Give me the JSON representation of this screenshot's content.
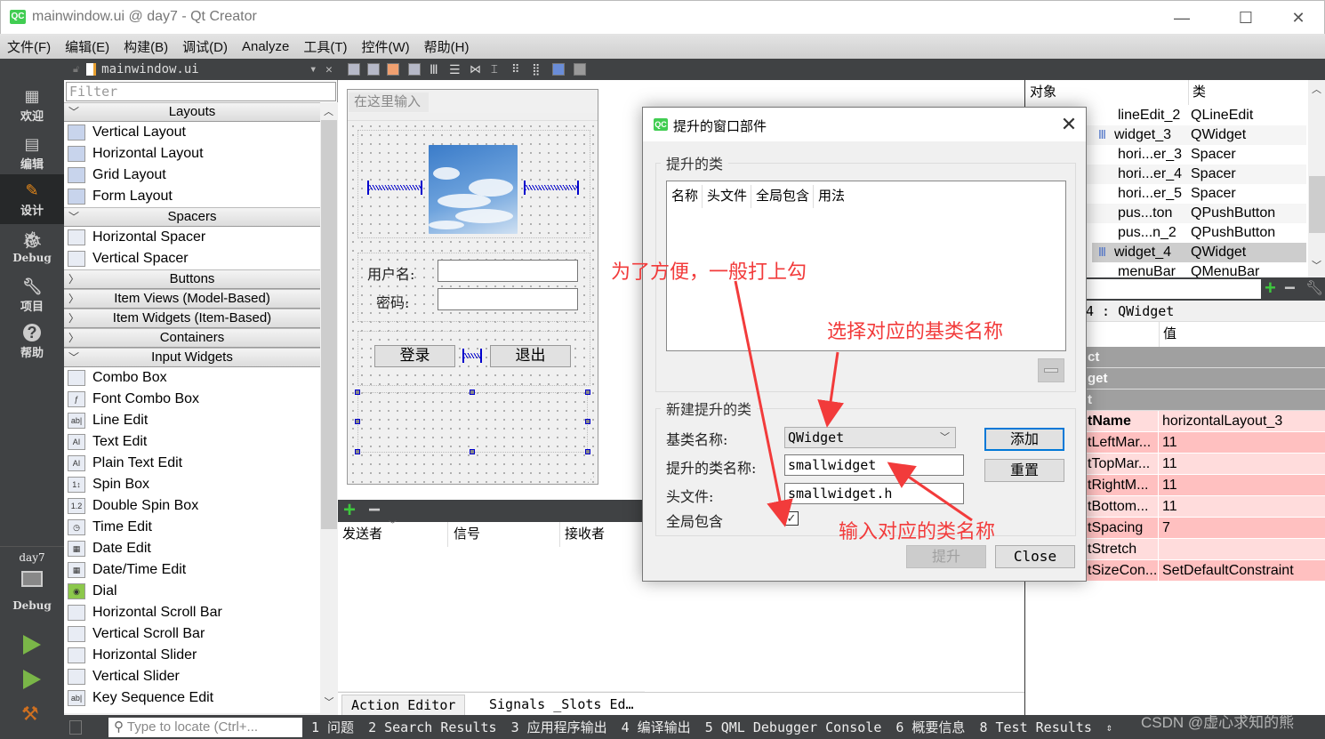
{
  "window": {
    "title": "mainwindow.ui @ day7 - Qt Creator",
    "app_icon": "QC",
    "controls": {
      "minimize": "—",
      "maximize": "☐",
      "close": "✕"
    }
  },
  "menu": [
    "文件(F)",
    "编辑(E)",
    "构建(B)",
    "调试(D)",
    "Analyze",
    "工具(T)",
    "控件(W)",
    "帮助(H)"
  ],
  "editor_tab": {
    "file": "mainwindow.ui",
    "dropdown": "▾",
    "close": "✕"
  },
  "modes": [
    {
      "label": "欢迎",
      "icon": "grid-icon"
    },
    {
      "label": "编辑",
      "icon": "document-icon"
    },
    {
      "label": "设计",
      "icon": "pencil-icon",
      "active": true
    },
    {
      "label": "Debug",
      "icon": "bug-icon"
    },
    {
      "label": "项目",
      "icon": "wrench-icon"
    },
    {
      "label": "帮助",
      "icon": "help-icon"
    }
  ],
  "kit": {
    "project": "day7",
    "mode": "Debug"
  },
  "widget_box": {
    "filter_placeholder": "Filter",
    "categories": [
      {
        "name": "Layouts",
        "expanded": true,
        "items": [
          "Vertical Layout",
          "Horizontal Layout",
          "Grid Layout",
          "Form Layout"
        ]
      },
      {
        "name": "Spacers",
        "expanded": true,
        "items": [
          "Horizontal Spacer",
          "Vertical Spacer"
        ]
      },
      {
        "name": "Buttons",
        "expanded": false,
        "items": []
      },
      {
        "name": "Item Views (Model-Based)",
        "expanded": false,
        "items": []
      },
      {
        "name": "Item Widgets (Item-Based)",
        "expanded": false,
        "items": []
      },
      {
        "name": "Containers",
        "expanded": false,
        "items": []
      },
      {
        "name": "Input Widgets",
        "expanded": true,
        "items": [
          "Combo Box",
          "Font Combo Box",
          "Line Edit",
          "Text Edit",
          "Plain Text Edit",
          "Spin Box",
          "Double Spin Box",
          "Time Edit",
          "Date Edit",
          "Date/Time Edit",
          "Dial",
          "Horizontal Scroll Bar",
          "Vertical Scroll Bar",
          "Horizontal Slider",
          "Vertical Slider",
          "Key Sequence Edit"
        ]
      }
    ]
  },
  "form": {
    "menu_placeholder": "在这里输入",
    "username_label": "用户名:",
    "password_label": "密码:",
    "login_button": "登录",
    "exit_button": "退出"
  },
  "signals_slots": {
    "add": "+",
    "remove": "−",
    "columns": [
      "发送者",
      "信号",
      "接收者"
    ]
  },
  "bottom_tabs": [
    "Action Editor",
    "Signals _Slots Ed…"
  ],
  "status_bar": {
    "locator_placeholder": "Type to locate (Ctrl+...",
    "items": [
      "1 问题",
      "2 Search Results",
      "3 应用程序输出",
      "4 编译输出",
      "5 QML Debugger Console",
      "6 概要信息",
      "8 Test Results"
    ]
  },
  "object_inspector": {
    "columns": [
      "对象",
      "类"
    ],
    "rows": [
      {
        "object": "lineEdit_2",
        "class": "QLineEdit",
        "icon": false
      },
      {
        "object": "widget_3",
        "class": "QWidget",
        "icon": true
      },
      {
        "object": "hori...er_3",
        "class": "Spacer",
        "icon": false
      },
      {
        "object": "hori...er_4",
        "class": "Spacer",
        "icon": false
      },
      {
        "object": "hori...er_5",
        "class": "Spacer",
        "icon": false
      },
      {
        "object": "pus...ton",
        "class": "QPushButton",
        "icon": false
      },
      {
        "object": "pus...n_2",
        "class": "QPushButton",
        "icon": false
      },
      {
        "object": "widget_4",
        "class": "QWidget",
        "icon": true,
        "selected": true
      },
      {
        "object": "menuBar",
        "class": "QMenuBar",
        "icon": false
      }
    ]
  },
  "property_editor": {
    "class_line": "4 : QWidget",
    "value_header": "值",
    "groups": [
      "ct",
      "get",
      "t"
    ],
    "rows": [
      {
        "name": "tName",
        "value": "horizontalLayout_3",
        "bold": true
      },
      {
        "name": "tLeftMar...",
        "value": "11"
      },
      {
        "name": "tTopMar...",
        "value": "11"
      },
      {
        "name": "tRightM...",
        "value": "11"
      },
      {
        "name": "tBottom...",
        "value": "11"
      },
      {
        "name": "tSpacing",
        "value": "7"
      },
      {
        "name": "tStretch",
        "value": ""
      },
      {
        "name": "tSizeCon...",
        "value": "SetDefaultConstraint"
      }
    ]
  },
  "dialog": {
    "title": "提升的窗口部件",
    "promoted_group": "提升的类",
    "table_columns": [
      "名称",
      "头文件",
      "全局包含",
      "用法"
    ],
    "new_group": "新建提升的类",
    "base_class_label": "基类名称:",
    "base_class_value": "QWidget",
    "promoted_name_label": "提升的类名称:",
    "promoted_name_value": "smallwidget",
    "header_label": "头文件:",
    "header_value": "smallwidget.h",
    "global_include_label": "全局包含",
    "global_include_checked": true,
    "add_button": "添加",
    "reset_button": "重置",
    "promote_button": "提升",
    "close_button": "Close"
  },
  "annotations": {
    "checkbox_hint": "为了方便，一般打上勾",
    "base_class_hint": "选择对应的基类名称",
    "class_name_hint": "输入对应的类名称",
    "color": "#f23b3b"
  },
  "watermark": "CSDN @虚心求知的熊"
}
